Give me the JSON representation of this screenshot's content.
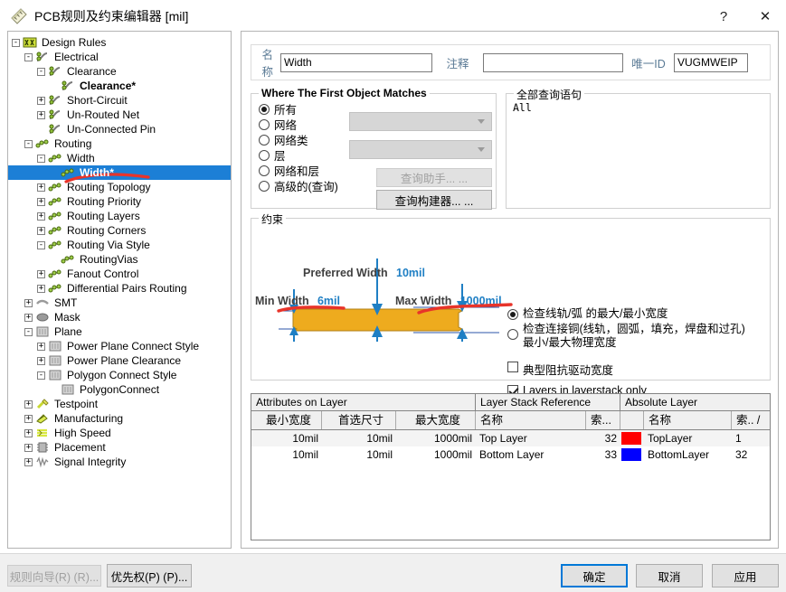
{
  "window": {
    "title": "PCB规则及约束编辑器 [mil]",
    "icon": "ruler-icon",
    "help_label": "?",
    "close_label": "✕"
  },
  "tree": {
    "nodes": [
      {
        "label": "Design Rules",
        "depth": 0,
        "expander": "-",
        "icon": "design-rules-icon"
      },
      {
        "label": "Electrical",
        "depth": 1,
        "expander": "-",
        "icon": "electrical-icon"
      },
      {
        "label": "Clearance",
        "depth": 2,
        "expander": "-",
        "icon": "electrical-icon"
      },
      {
        "label": "Clearance*",
        "depth": 3,
        "expander": "",
        "icon": "electrical-icon",
        "bold": true
      },
      {
        "label": "Short-Circuit",
        "depth": 2,
        "expander": "+",
        "icon": "electrical-icon"
      },
      {
        "label": "Un-Routed Net",
        "depth": 2,
        "expander": "+",
        "icon": "electrical-icon"
      },
      {
        "label": "Un-Connected Pin",
        "depth": 2,
        "expander": "",
        "icon": "electrical-icon"
      },
      {
        "label": "Routing",
        "depth": 1,
        "expander": "-",
        "icon": "routing-icon"
      },
      {
        "label": "Width",
        "depth": 2,
        "expander": "-",
        "icon": "routing-icon"
      },
      {
        "label": "Width*",
        "depth": 3,
        "expander": "",
        "icon": "routing-icon",
        "selected": true
      },
      {
        "label": "Routing Topology",
        "depth": 2,
        "expander": "+",
        "icon": "routing-icon"
      },
      {
        "label": "Routing Priority",
        "depth": 2,
        "expander": "+",
        "icon": "routing-icon"
      },
      {
        "label": "Routing Layers",
        "depth": 2,
        "expander": "+",
        "icon": "routing-icon"
      },
      {
        "label": "Routing Corners",
        "depth": 2,
        "expander": "+",
        "icon": "routing-icon"
      },
      {
        "label": "Routing Via Style",
        "depth": 2,
        "expander": "-",
        "icon": "routing-icon"
      },
      {
        "label": "RoutingVias",
        "depth": 3,
        "expander": "",
        "icon": "routing-icon"
      },
      {
        "label": "Fanout Control",
        "depth": 2,
        "expander": "+",
        "icon": "routing-icon"
      },
      {
        "label": "Differential Pairs Routing",
        "depth": 2,
        "expander": "+",
        "icon": "routing-icon"
      },
      {
        "label": "SMT",
        "depth": 1,
        "expander": "+",
        "icon": "smt-icon"
      },
      {
        "label": "Mask",
        "depth": 1,
        "expander": "+",
        "icon": "mask-icon"
      },
      {
        "label": "Plane",
        "depth": 1,
        "expander": "-",
        "icon": "plane-icon"
      },
      {
        "label": "Power Plane Connect Style",
        "depth": 2,
        "expander": "+",
        "icon": "plane-icon"
      },
      {
        "label": "Power Plane Clearance",
        "depth": 2,
        "expander": "+",
        "icon": "plane-icon"
      },
      {
        "label": "Polygon Connect Style",
        "depth": 2,
        "expander": "-",
        "icon": "plane-icon"
      },
      {
        "label": "PolygonConnect",
        "depth": 3,
        "expander": "",
        "icon": "plane-icon"
      },
      {
        "label": "Testpoint",
        "depth": 1,
        "expander": "+",
        "icon": "testpoint-icon"
      },
      {
        "label": "Manufacturing",
        "depth": 1,
        "expander": "+",
        "icon": "manufacturing-icon"
      },
      {
        "label": "High Speed",
        "depth": 1,
        "expander": "+",
        "icon": "high-speed-icon"
      },
      {
        "label": "Placement",
        "depth": 1,
        "expander": "+",
        "icon": "placement-icon"
      },
      {
        "label": "Signal Integrity",
        "depth": 1,
        "expander": "+",
        "icon": "signal-integrity-icon"
      }
    ]
  },
  "form": {
    "name_label": "名称",
    "name_value": "Width",
    "comment_label": "注释",
    "comment_value": "",
    "unique_id_label": "唯一ID",
    "unique_id_value": "VUGMWEIP"
  },
  "matches": {
    "group_label": "Where The First Object Matches",
    "options": [
      {
        "label": "所有",
        "selected": true
      },
      {
        "label": "网络",
        "selected": false
      },
      {
        "label": "网络类",
        "selected": false
      },
      {
        "label": "层",
        "selected": false
      },
      {
        "label": "网络和层",
        "selected": false
      },
      {
        "label": "高级的(查询)",
        "selected": false
      }
    ],
    "combo_net_value": "",
    "combo_netclass_value": "",
    "query_helper_button": "查询助手... ...",
    "query_builder_button": "查询构建器... ..."
  },
  "query": {
    "group_label": "全部查询语句",
    "text": "All"
  },
  "constraint": {
    "group_label": "约束",
    "preferred_label": "Preferred Width",
    "preferred_value": "10mil",
    "min_label": "Min Width",
    "min_value": "6mil",
    "max_label": "Max Width",
    "max_value": "1000mil",
    "trace_color": "#eeab1e",
    "arrow_color": "#1f7fc4",
    "annotation_color": "#e8342a",
    "options": [
      {
        "label": "检查线轨/弧 的最大/最小宽度",
        "selected": true
      },
      {
        "label": "检查连接铜(线轨，圆弧，填充，焊盘和过孔)最小/最大物理宽度",
        "selected": false
      }
    ],
    "checkboxes": [
      {
        "label": "典型阻抗驱动宽度",
        "checked": false
      },
      {
        "label": "Layers in layerstack only",
        "checked": true
      }
    ]
  },
  "table": {
    "group_headers": [
      "Attributes on Layer",
      "Layer Stack Reference",
      "Absolute Layer"
    ],
    "columns": [
      "最小宽度",
      "首选尺寸",
      "最大宽度",
      "名称",
      "索...",
      "",
      "名称",
      "索.. /"
    ],
    "rows": [
      {
        "min_width": "10mil",
        "preferred": "10mil",
        "max_width": "1000mil",
        "stack_name": "Top Layer",
        "stack_index": "32",
        "color": "#ff0000",
        "abs_name": "TopLayer",
        "abs_index": "1"
      },
      {
        "min_width": "10mil",
        "preferred": "10mil",
        "max_width": "1000mil",
        "stack_name": "Bottom Layer",
        "stack_index": "33",
        "color": "#0000ff",
        "abs_name": "BottomLayer",
        "abs_index": "32"
      }
    ]
  },
  "footer": {
    "rule_wizard": "规则向导(R) (R)...",
    "priority": "优先权(P) (P)...",
    "ok": "确定",
    "cancel": "取消",
    "apply": "应用"
  }
}
